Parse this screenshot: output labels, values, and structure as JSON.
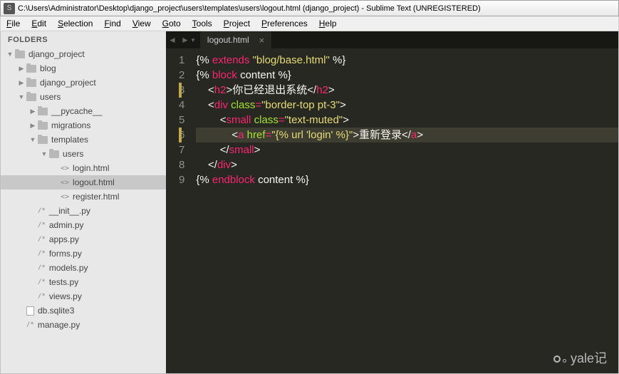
{
  "title": "C:\\Users\\Administrator\\Desktop\\django_project\\users\\templates\\users\\logout.html (django_project) - Sublime Text (UNREGISTERED)",
  "menu": [
    "File",
    "Edit",
    "Selection",
    "Find",
    "View",
    "Goto",
    "Tools",
    "Project",
    "Preferences",
    "Help"
  ],
  "sidebar": {
    "header": "FOLDERS",
    "items": [
      {
        "d": 0,
        "t": "folder",
        "a": "down",
        "l": "django_project"
      },
      {
        "d": 1,
        "t": "folder",
        "a": "right",
        "l": "blog"
      },
      {
        "d": 1,
        "t": "folder",
        "a": "right",
        "l": "django_project"
      },
      {
        "d": 1,
        "t": "folder",
        "a": "down",
        "l": "users"
      },
      {
        "d": 2,
        "t": "folder",
        "a": "right",
        "l": "__pycache__"
      },
      {
        "d": 2,
        "t": "folder",
        "a": "right",
        "l": "migrations"
      },
      {
        "d": 2,
        "t": "folder",
        "a": "down",
        "l": "templates"
      },
      {
        "d": 3,
        "t": "folder",
        "a": "down",
        "l": "users"
      },
      {
        "d": 4,
        "t": "ang",
        "l": "login.html"
      },
      {
        "d": 4,
        "t": "ang",
        "l": "logout.html",
        "sel": true
      },
      {
        "d": 4,
        "t": "ang",
        "l": "register.html"
      },
      {
        "d": 2,
        "t": "cmt",
        "l": "__init__.py"
      },
      {
        "d": 2,
        "t": "cmt",
        "l": "admin.py"
      },
      {
        "d": 2,
        "t": "cmt",
        "l": "apps.py"
      },
      {
        "d": 2,
        "t": "cmt",
        "l": "forms.py"
      },
      {
        "d": 2,
        "t": "cmt",
        "l": "models.py"
      },
      {
        "d": 2,
        "t": "cmt",
        "l": "tests.py"
      },
      {
        "d": 2,
        "t": "cmt",
        "l": "views.py"
      },
      {
        "d": 1,
        "t": "doc",
        "l": "db.sqlite3"
      },
      {
        "d": 1,
        "t": "cmt",
        "l": "manage.py"
      }
    ]
  },
  "tab": {
    "label": "logout.html"
  },
  "code": {
    "mod_lines": [
      3,
      6
    ],
    "lines": [
      [
        {
          "c": "s-y",
          "t": "{% "
        },
        {
          "c": "s-tag",
          "t": "extends"
        },
        {
          "c": "s-y",
          "t": " "
        },
        {
          "c": "s-str",
          "t": "\"blog/base.html\""
        },
        {
          "c": "s-y",
          "t": " %}"
        }
      ],
      [
        {
          "c": "s-y",
          "t": "{% "
        },
        {
          "c": "s-tag",
          "t": "block"
        },
        {
          "c": "s-y",
          "t": " "
        },
        {
          "c": "s-txt",
          "t": "content"
        },
        {
          "c": "s-y",
          "t": " %}"
        }
      ],
      [
        {
          "c": "s-y",
          "t": "    "
        },
        {
          "c": "s-pun",
          "t": "<"
        },
        {
          "c": "s-tag",
          "t": "h2"
        },
        {
          "c": "s-pun",
          "t": ">"
        },
        {
          "c": "s-txt",
          "t": "你已经退出系统"
        },
        {
          "c": "s-pun",
          "t": "</"
        },
        {
          "c": "s-tag",
          "t": "h2"
        },
        {
          "c": "s-pun",
          "t": ">"
        }
      ],
      [
        {
          "c": "s-y",
          "t": "    "
        },
        {
          "c": "s-pun",
          "t": "<"
        },
        {
          "c": "s-tag",
          "t": "div"
        },
        {
          "c": "s-y",
          "t": " "
        },
        {
          "c": "s-attr",
          "t": "class"
        },
        {
          "c": "s-op",
          "t": "="
        },
        {
          "c": "s-str",
          "t": "\"border-top pt-3\""
        },
        {
          "c": "s-pun",
          "t": ">"
        }
      ],
      [
        {
          "c": "s-y",
          "t": "        "
        },
        {
          "c": "s-pun",
          "t": "<"
        },
        {
          "c": "s-tag",
          "t": "small"
        },
        {
          "c": "s-y",
          "t": " "
        },
        {
          "c": "s-attr",
          "t": "class"
        },
        {
          "c": "s-op",
          "t": "="
        },
        {
          "c": "s-str",
          "t": "\"text-muted\""
        },
        {
          "c": "s-pun",
          "t": ">"
        }
      ],
      [
        {
          "c": "s-y",
          "t": "            "
        },
        {
          "c": "s-pun",
          "t": "<"
        },
        {
          "c": "s-tag",
          "t": "a"
        },
        {
          "c": "s-y",
          "t": " "
        },
        {
          "c": "s-attr",
          "t": "href"
        },
        {
          "c": "s-op",
          "t": "="
        },
        {
          "c": "s-str",
          "t": "\"{% url 'login' %}\""
        },
        {
          "c": "s-pun",
          "t": ">"
        },
        {
          "c": "s-txt",
          "t": "重新登录"
        },
        {
          "c": "s-pun",
          "t": "</"
        },
        {
          "c": "s-tag",
          "t": "a"
        },
        {
          "c": "s-pun",
          "t": ">"
        }
      ],
      [
        {
          "c": "s-y",
          "t": "        "
        },
        {
          "c": "s-pun",
          "t": "</"
        },
        {
          "c": "s-tag",
          "t": "small"
        },
        {
          "c": "s-pun",
          "t": ">"
        }
      ],
      [
        {
          "c": "s-y",
          "t": "    "
        },
        {
          "c": "s-pun",
          "t": "</"
        },
        {
          "c": "s-tag",
          "t": "div"
        },
        {
          "c": "s-pun",
          "t": ">"
        }
      ],
      [
        {
          "c": "s-y",
          "t": "{% "
        },
        {
          "c": "s-tag",
          "t": "endblock"
        },
        {
          "c": "s-y",
          "t": " "
        },
        {
          "c": "s-txt",
          "t": "content"
        },
        {
          "c": "s-y",
          "t": " %}"
        }
      ]
    ]
  },
  "watermark": "yale记"
}
